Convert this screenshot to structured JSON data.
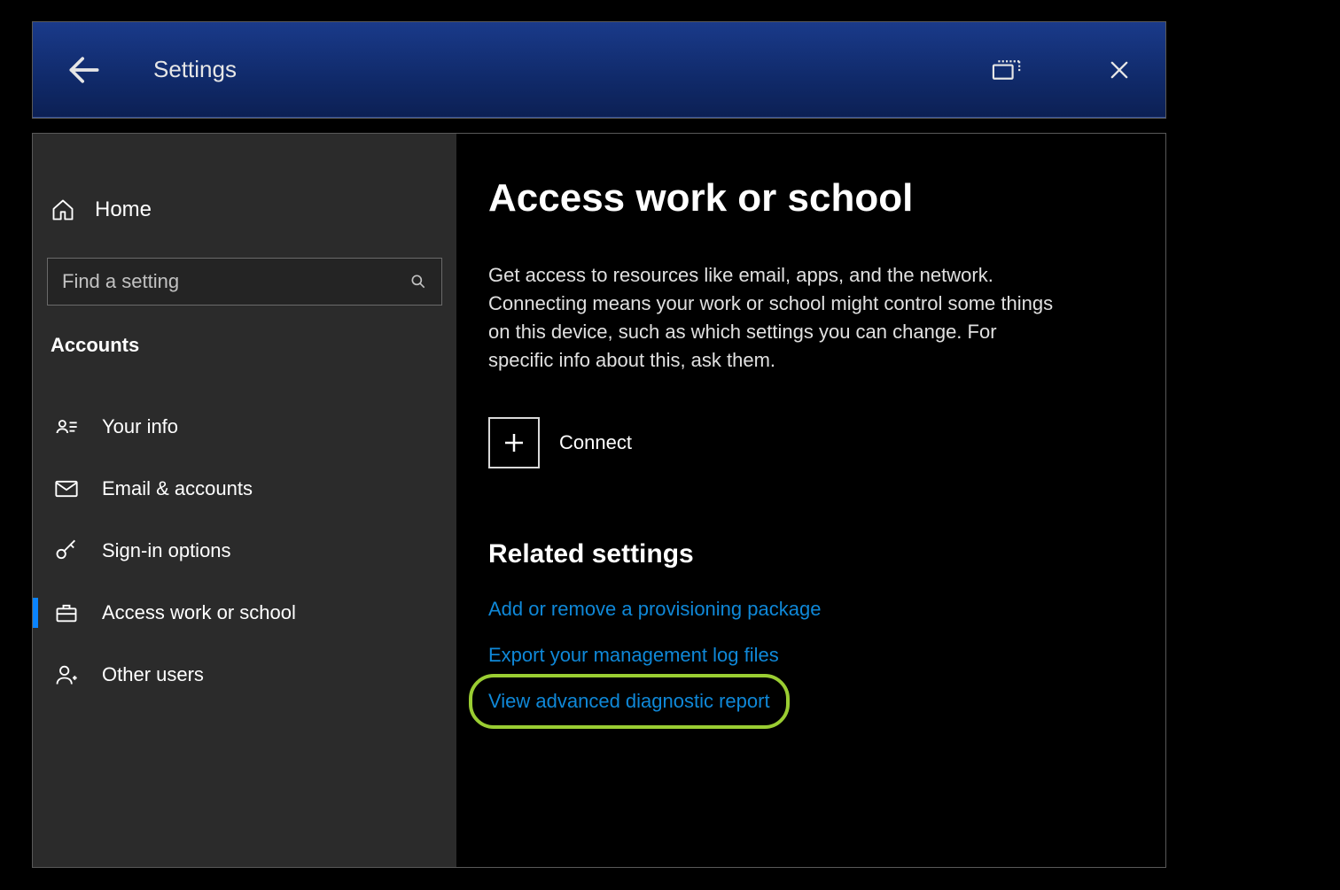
{
  "titlebar": {
    "title": "Settings"
  },
  "sidebar": {
    "home_label": "Home",
    "search_placeholder": "Find a setting",
    "section_label": "Accounts",
    "items": [
      {
        "label": "Your info"
      },
      {
        "label": "Email & accounts"
      },
      {
        "label": "Sign-in options"
      },
      {
        "label": "Access work or school"
      },
      {
        "label": "Other users"
      }
    ]
  },
  "main": {
    "heading": "Access work or school",
    "description": "Get access to resources like email, apps, and the network. Connecting means your work or school might control some things on this device, such as which settings you can change. For specific info about this, ask them.",
    "connect_label": "Connect",
    "related_heading": "Related settings",
    "links": [
      "Add or remove a provisioning package",
      "Export your management log files",
      "View advanced diagnostic report"
    ]
  },
  "highlight": {
    "target_link_index": 2
  }
}
